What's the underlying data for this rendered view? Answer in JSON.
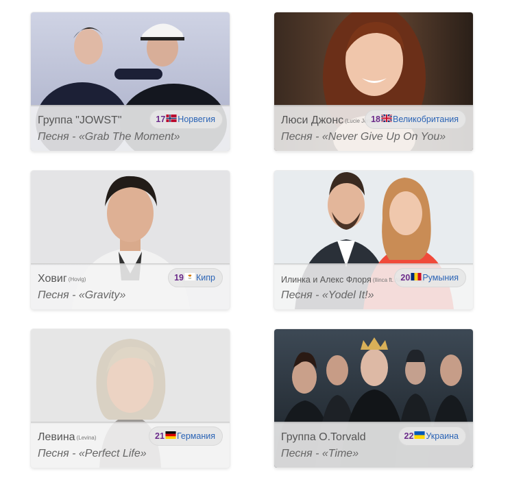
{
  "cards": [
    {
      "artist": "Группа \"JOWST\"",
      "original": "",
      "song_prefix": "Песня - ",
      "song_title": "«Grab The Moment»",
      "number": "17",
      "country": "Норвегия",
      "flag_icon": "norway-flag-icon"
    },
    {
      "artist": "Люси Джонс",
      "original": "(Lucie Jones)",
      "song_prefix": "Песня - ",
      "song_title": "«Never Give Up On You»",
      "number": "18",
      "country": "Великобритания",
      "flag_icon": "uk-flag-icon"
    },
    {
      "artist": "Ховиг",
      "original": "(Hovig)",
      "song_prefix": "Песня - ",
      "song_title": "«Gravity»",
      "number": "19",
      "country": "Кипр",
      "flag_icon": "cyprus-flag-icon"
    },
    {
      "artist": "Илинка и Алекс Флоря",
      "original": "(Ilinca ft. Alex Florea)",
      "song_prefix": "Песня - ",
      "song_title": "«Yodel It!»",
      "number": "20",
      "country": "Румыния",
      "flag_icon": "romania-flag-icon"
    },
    {
      "artist": "Левина",
      "original": "(Levina)",
      "song_prefix": "Песня - ",
      "song_title": "«Perfect Life»",
      "number": "21",
      "country": "Германия",
      "flag_icon": "germany-flag-icon"
    },
    {
      "artist": "Группа O.Torvald",
      "original": "",
      "song_prefix": "Песня - ",
      "song_title": "«Time»",
      "number": "22",
      "country": "Украина",
      "flag_icon": "ukraine-flag-icon"
    }
  ],
  "colors": {
    "number": "#6b2b8a",
    "country_link": "#2a63b5",
    "artist_text": "#555555",
    "song_text": "#666666"
  }
}
